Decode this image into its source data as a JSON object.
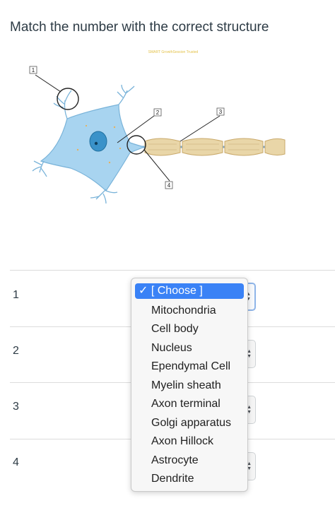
{
  "question": {
    "title": "Match the number with the correct structure"
  },
  "figure": {
    "watermark": "SMART GrowthSession Trusted",
    "labels": [
      "1",
      "2",
      "3",
      "4"
    ]
  },
  "rows": [
    {
      "number": "1"
    },
    {
      "number": "2"
    },
    {
      "number": "3"
    },
    {
      "number": "4"
    }
  ],
  "dropdown": {
    "selected_mark": "✓",
    "options": [
      "[ Choose ]",
      "Mitochondria",
      "Cell body",
      "Nucleus",
      "Ependymal Cell",
      "Myelin sheath",
      "Axon terminal",
      "Golgi apparatus",
      "Axon Hillock",
      "Astrocyte",
      "Dendrite"
    ]
  },
  "colors": {
    "accent": "#3a82f6",
    "cell_body": "#a8d4f0",
    "myelin": "#e7d3a5"
  }
}
